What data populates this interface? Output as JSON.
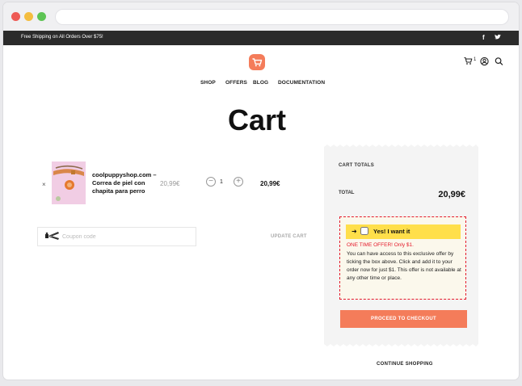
{
  "topbar": {
    "shipping_text": "Free Shipping on All Orders Over $75!",
    "social_icons": [
      "facebook-icon",
      "twitter-icon"
    ]
  },
  "header": {
    "logo_icon": "shopping-cart-icon",
    "cart_count": "1",
    "icons": [
      "cart-icon",
      "user-icon",
      "search-icon"
    ]
  },
  "nav": {
    "items": [
      "SHOP",
      "OFFERS",
      "BLOG",
      "DOCUMENTATION"
    ]
  },
  "page": {
    "title": "Cart"
  },
  "cart_item": {
    "remove_symbol": "×",
    "product_name": "coolpuppyshop.com – Correa de piel con chapita para perro",
    "price": "20,99€",
    "quantity": "1",
    "subtotal": "20,99€"
  },
  "coupon": {
    "placeholder": "Coupon code",
    "update_label": "UPDATE CART"
  },
  "totals": {
    "title": "CART TOTALS",
    "total_label": "TOTAL",
    "total_value": "20,99€"
  },
  "offer": {
    "want_label": "Yes! I want it",
    "headline": "ONE TIME OFFER! Only $1.",
    "description": "You can have access to this exclusive offer by ticking the box above. Click and add it to your order now for just $1. This offer is not available at any other time or place."
  },
  "checkout_label": "PROCEED TO CHECKOUT",
  "continue_label": "CONTINUE SHOPPING",
  "colors": {
    "accent": "#f47c5a",
    "offer_border": "#e51a2b",
    "offer_bar": "#ffdf4a",
    "topbar_bg": "#2b2b2b"
  }
}
